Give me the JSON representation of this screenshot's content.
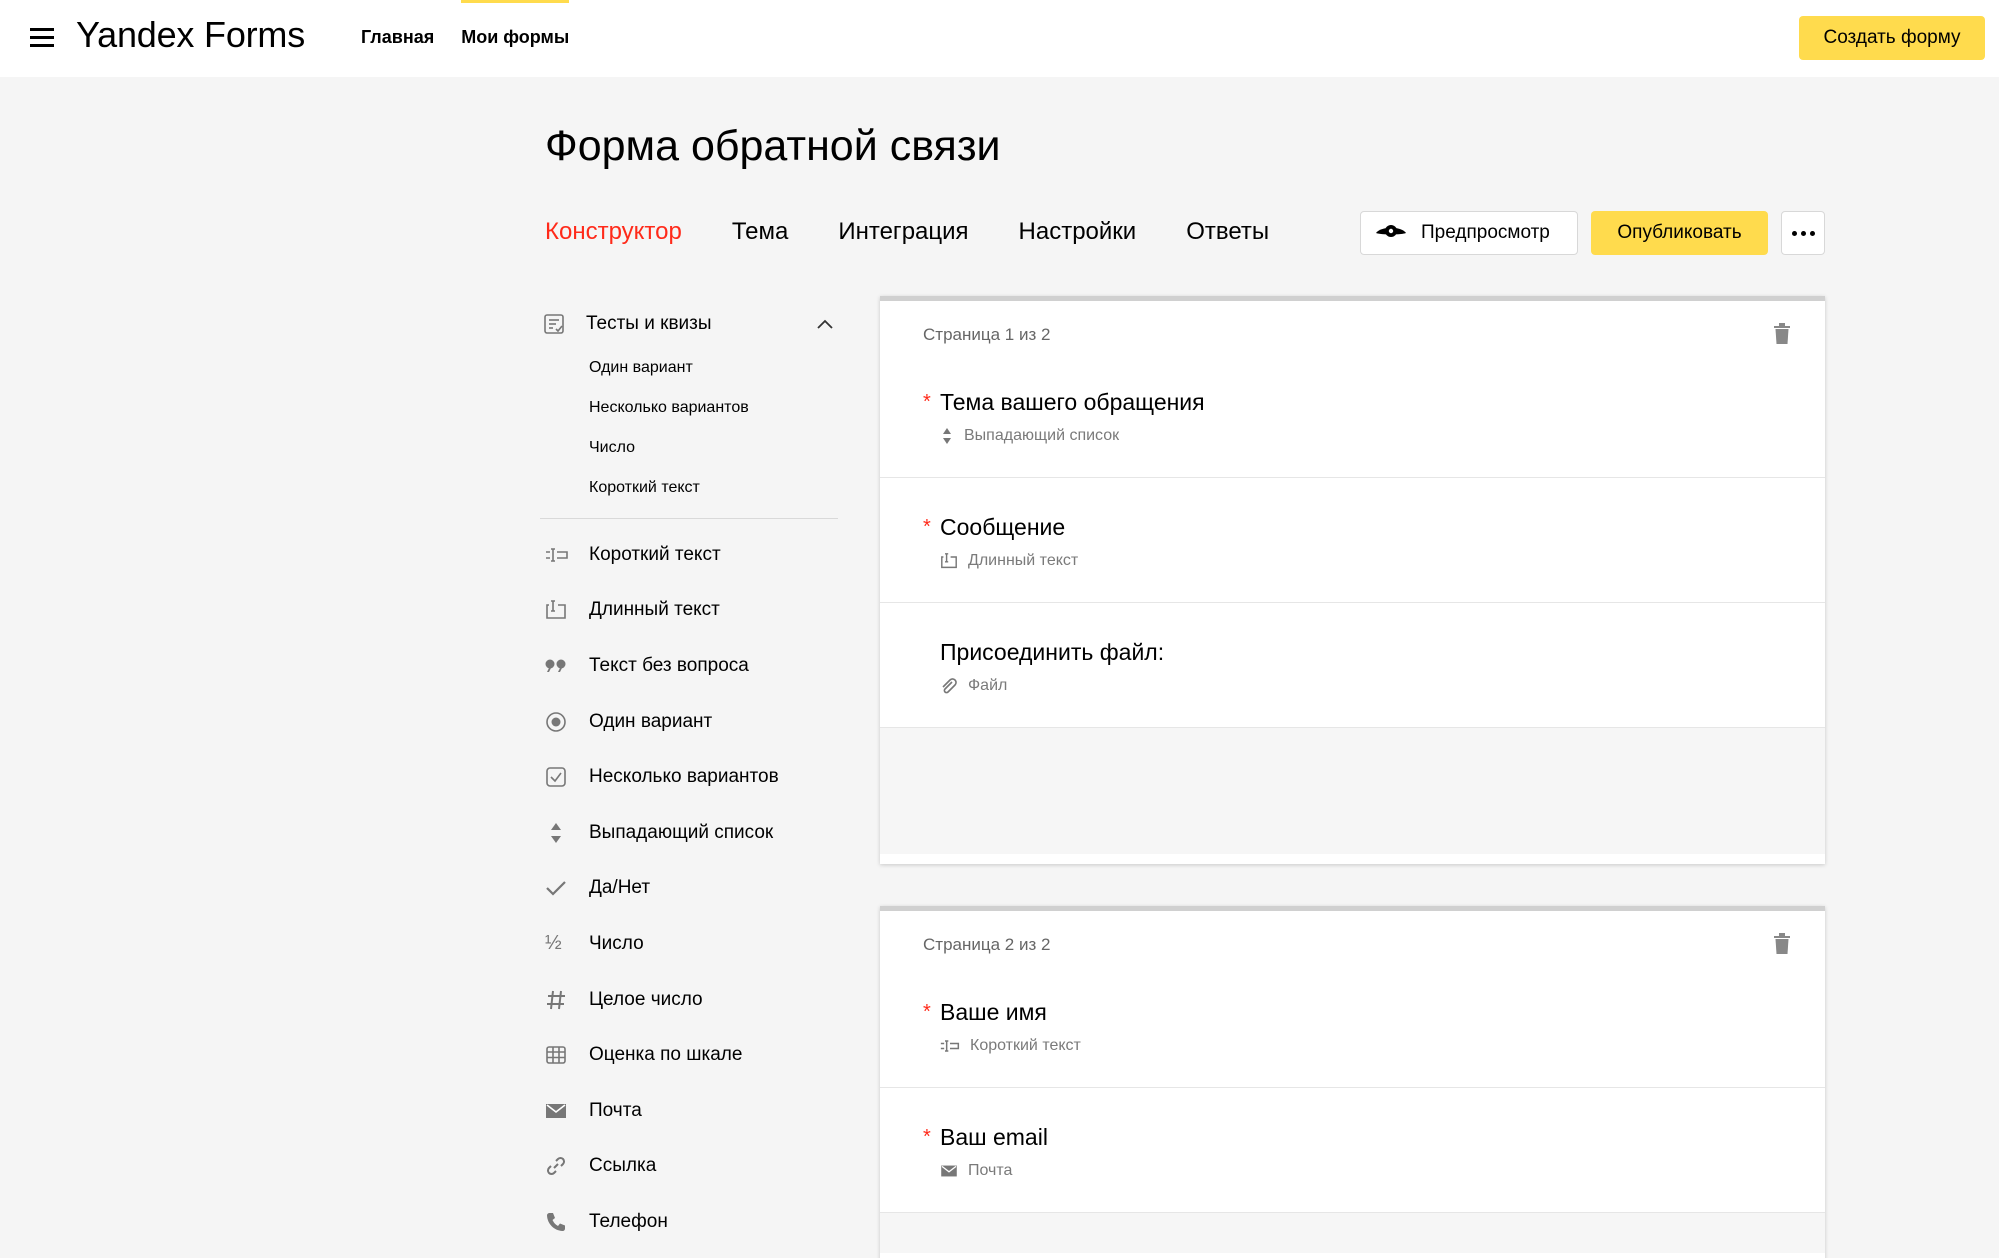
{
  "app": {
    "logo": "Yandex Forms"
  },
  "topnav": [
    {
      "label": "Главная",
      "active": false
    },
    {
      "label": "Мои формы",
      "active": true
    }
  ],
  "header": {
    "create_label": "Создать форму"
  },
  "form": {
    "title": "Форма обратной связи"
  },
  "tabs": [
    {
      "label": "Конструктор",
      "active": true
    },
    {
      "label": "Тема",
      "active": false
    },
    {
      "label": "Интеграция",
      "active": false
    },
    {
      "label": "Настройки",
      "active": false
    },
    {
      "label": "Ответы",
      "active": false
    }
  ],
  "actions": {
    "preview_label": "Предпросмотр",
    "publish_label": "Опубликовать"
  },
  "sidebar": {
    "group": {
      "label": "Тесты и квизы",
      "items": [
        "Один вариант",
        "Несколько вариантов",
        "Число",
        "Короткий текст"
      ]
    },
    "items": [
      {
        "label": "Короткий текст",
        "icon": "short-text-icon"
      },
      {
        "label": "Длинный текст",
        "icon": "long-text-icon"
      },
      {
        "label": "Текст без вопроса",
        "icon": "quote-icon"
      },
      {
        "label": "Один вариант",
        "icon": "radio-icon"
      },
      {
        "label": "Несколько вариантов",
        "icon": "checkbox-icon"
      },
      {
        "label": "Выпадающий список",
        "icon": "dropdown-icon"
      },
      {
        "label": "Да/Нет",
        "icon": "check-icon"
      },
      {
        "label": "Число",
        "icon": "fraction-icon"
      },
      {
        "label": "Целое число",
        "icon": "hash-icon"
      },
      {
        "label": "Оценка по шкале",
        "icon": "grid-icon"
      },
      {
        "label": "Почта",
        "icon": "mail-icon"
      },
      {
        "label": "Ссылка",
        "icon": "link-icon"
      },
      {
        "label": "Телефон",
        "icon": "phone-icon"
      }
    ]
  },
  "pages": [
    {
      "label": "Страница 1 из 2",
      "questions": [
        {
          "title": "Тема вашего обращения",
          "required": true,
          "type": "Выпадающий список",
          "icon": "dropdown-icon"
        },
        {
          "title": "Сообщение",
          "required": true,
          "type": "Длинный текст",
          "icon": "long-text-icon"
        },
        {
          "title": "Присоединить файл:",
          "required": false,
          "type": "Файл",
          "icon": "paperclip-icon"
        }
      ]
    },
    {
      "label": "Страница 2 из 2",
      "questions": [
        {
          "title": "Ваше имя",
          "required": true,
          "type": "Короткий текст",
          "icon": "short-text-icon"
        },
        {
          "title": "Ваш email",
          "required": true,
          "type": "Почта",
          "icon": "mail-icon"
        }
      ]
    }
  ],
  "colors": {
    "accent": "#ffdb4d",
    "active_tab": "#ff2a1a",
    "required": "#ff2a1a"
  }
}
